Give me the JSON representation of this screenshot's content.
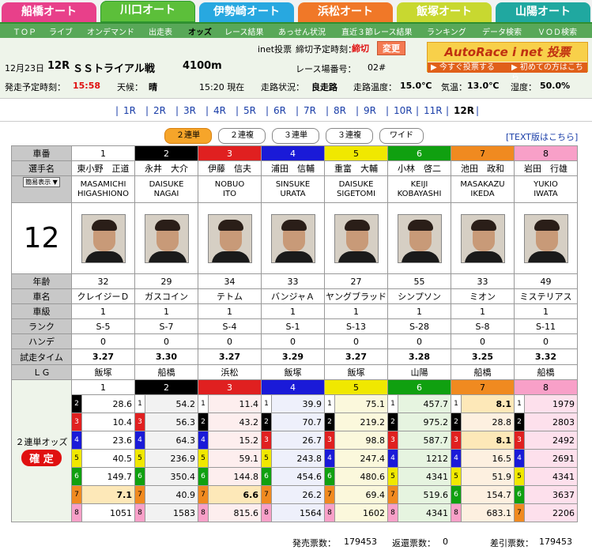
{
  "nav_tabs": [
    {
      "label": "船橋オート",
      "color": "#e8408a"
    },
    {
      "label": "川口オート",
      "color": "#5cbf3a",
      "active": true
    },
    {
      "label": "伊勢崎オート",
      "color": "#28a8e0"
    },
    {
      "label": "浜松オート",
      "color": "#f07828"
    },
    {
      "label": "飯塚オート",
      "color": "#c8d830"
    },
    {
      "label": "山陽オート",
      "color": "#20a8a0"
    }
  ],
  "subnav": [
    "ＴＯＰ",
    "ライブ",
    "オンデマンド",
    "出走表",
    "オッズ",
    "レース結果",
    "あっせん状況",
    "直近３節レース結果",
    "ランキング",
    "データ検索",
    "ＶＯＤ検索"
  ],
  "info": {
    "date": "12月23日",
    "race_no": "12R",
    "race_name": "ＳＳトライアル戦",
    "distance": "4100m",
    "inet_label": "inet投票",
    "deadline_label": "締切予定時刻：",
    "deadline_value": "締切",
    "change_btn": "変更",
    "venue_label": "レース場番号：",
    "venue_value": "02#",
    "start_label": "発走予定時刻：",
    "start_value": "15:58",
    "weather_label": "天候：",
    "weather_value": "晴",
    "now_value": "15:20 現在",
    "track_label": "走路状況：",
    "track_value": "良走路",
    "track_temp_label": "走路温度：",
    "track_temp_value": "15.0℃",
    "air_temp_label": "気温：",
    "air_temp_value": "13.0℃",
    "humidity_label": "湿度：",
    "humidity_value": "50.0%"
  },
  "banner": {
    "title": "AutoRace i net 投票",
    "left": "▶ 今すぐ投票する",
    "right": "▶ 初めての方はこちら"
  },
  "races": [
    "1R",
    "2R",
    "3R",
    "4R",
    "5R",
    "6R",
    "7R",
    "8R",
    "9R",
    "10R",
    "11R",
    "12R"
  ],
  "bet_buttons": [
    "２連単",
    "２連複",
    "３連単",
    "３連複",
    "ワイド"
  ],
  "text_link": "[TEXT版はこちら]",
  "table": {
    "h_num": "車番",
    "h_name": "選手名",
    "h_display": "簡易表示",
    "race_big": "12",
    "h_age": "年齢",
    "h_bike": "車名",
    "h_class": "車級",
    "h_rank": "ランク",
    "h_handicap": "ハンデ",
    "h_trial": "試走タイム",
    "h_lg": "ＬＧ",
    "riders": [
      {
        "num": "1",
        "name": "東小野　正道",
        "roman1": "MASAMICHI",
        "roman2": "HIGASHIONO",
        "age": "32",
        "bike": "クレイジーＤ",
        "cls": "1",
        "rank": "S-5",
        "hc": "0",
        "trial": "3.27",
        "lg": "飯塚"
      },
      {
        "num": "2",
        "name": "永井　大介",
        "roman1": "DAISUKE",
        "roman2": "NAGAI",
        "age": "29",
        "bike": "ガスコイン",
        "cls": "1",
        "rank": "S-7",
        "hc": "0",
        "trial": "3.30",
        "lg": "船橋"
      },
      {
        "num": "3",
        "name": "伊藤　信夫",
        "roman1": "NOBUO",
        "roman2": "ITO",
        "age": "34",
        "bike": "テトム",
        "cls": "1",
        "rank": "S-4",
        "hc": "0",
        "trial": "3.27",
        "lg": "浜松"
      },
      {
        "num": "4",
        "name": "浦田　信輔",
        "roman1": "SINSUKE",
        "roman2": "URATA",
        "age": "33",
        "bike": "バンジャＡ",
        "cls": "1",
        "rank": "S-1",
        "hc": "0",
        "trial": "3.29",
        "lg": "飯塚"
      },
      {
        "num": "5",
        "name": "重富　大輔",
        "roman1": "DAISUKE",
        "roman2": "SIGETOMI",
        "age": "27",
        "bike": "ヤングブラッド",
        "cls": "1",
        "rank": "S-13",
        "hc": "0",
        "trial": "3.27",
        "lg": "飯塚"
      },
      {
        "num": "6",
        "name": "小林　啓二",
        "roman1": "KEIJI",
        "roman2": "KOBAYASHI",
        "age": "55",
        "bike": "シンプソン",
        "cls": "1",
        "rank": "S-28",
        "hc": "0",
        "trial": "3.28",
        "lg": "山陽"
      },
      {
        "num": "7",
        "name": "池田　政和",
        "roman1": "MASAKAZU",
        "roman2": "IKEDA",
        "age": "33",
        "bike": "ミオン",
        "cls": "1",
        "rank": "S-8",
        "hc": "0",
        "trial": "3.25",
        "lg": "船橋"
      },
      {
        "num": "8",
        "name": "岩田　行雄",
        "roman1": "YUKIO",
        "roman2": "IWATA",
        "age": "49",
        "bike": "ミステリアス",
        "cls": "1",
        "rank": "S-11",
        "hc": "0",
        "trial": "3.32",
        "lg": "船橋"
      }
    ],
    "odds_label": "２連単オッズ",
    "kakutei": "確 定",
    "odds": [
      [
        [
          "2",
          "28.6"
        ],
        [
          "3",
          "10.4"
        ],
        [
          "4",
          "23.6"
        ],
        [
          "5",
          "40.5"
        ],
        [
          "6",
          "149.7"
        ],
        [
          "7",
          "7.1"
        ],
        [
          "8",
          "1051"
        ]
      ],
      [
        [
          "1",
          "54.2"
        ],
        [
          "3",
          "56.3"
        ],
        [
          "4",
          "64.3"
        ],
        [
          "5",
          "236.9"
        ],
        [
          "6",
          "350.4"
        ],
        [
          "7",
          "40.9"
        ],
        [
          "8",
          "1583"
        ]
      ],
      [
        [
          "1",
          "11.4"
        ],
        [
          "2",
          "43.2"
        ],
        [
          "4",
          "15.2"
        ],
        [
          "5",
          "59.1"
        ],
        [
          "6",
          "144.8"
        ],
        [
          "7",
          "6.6"
        ],
        [
          "8",
          "815.6"
        ]
      ],
      [
        [
          "1",
          "39.9"
        ],
        [
          "2",
          "70.7"
        ],
        [
          "3",
          "26.7"
        ],
        [
          "5",
          "243.8"
        ],
        [
          "6",
          "454.6"
        ],
        [
          "7",
          "26.2"
        ],
        [
          "8",
          "1564"
        ]
      ],
      [
        [
          "1",
          "75.1"
        ],
        [
          "2",
          "219.2"
        ],
        [
          "3",
          "98.8"
        ],
        [
          "4",
          "247.4"
        ],
        [
          "6",
          "480.6"
        ],
        [
          "7",
          "69.4"
        ],
        [
          "8",
          "1602"
        ]
      ],
      [
        [
          "1",
          "457.7"
        ],
        [
          "2",
          "975.2"
        ],
        [
          "3",
          "587.7"
        ],
        [
          "4",
          "1212"
        ],
        [
          "5",
          "4341"
        ],
        [
          "7",
          "519.6"
        ],
        [
          "8",
          "4341"
        ]
      ],
      [
        [
          "1",
          "8.1"
        ],
        [
          "2",
          "28.8"
        ],
        [
          "3",
          "8.1"
        ],
        [
          "4",
          "16.5"
        ],
        [
          "5",
          "51.9"
        ],
        [
          "6",
          "154.7"
        ],
        [
          "8",
          "683.1"
        ]
      ],
      [
        [
          "1",
          "1979"
        ],
        [
          "2",
          "2803"
        ],
        [
          "3",
          "2492"
        ],
        [
          "4",
          "2691"
        ],
        [
          "5",
          "4341"
        ],
        [
          "6",
          "3637"
        ],
        [
          "7",
          "2206"
        ]
      ]
    ]
  },
  "footer": {
    "sold_label": "発売票数：",
    "sold_value": "179453",
    "returned_label": "返還票数：",
    "returned_value": "0",
    "net_label": "差引票数：",
    "net_value": "179453"
  }
}
